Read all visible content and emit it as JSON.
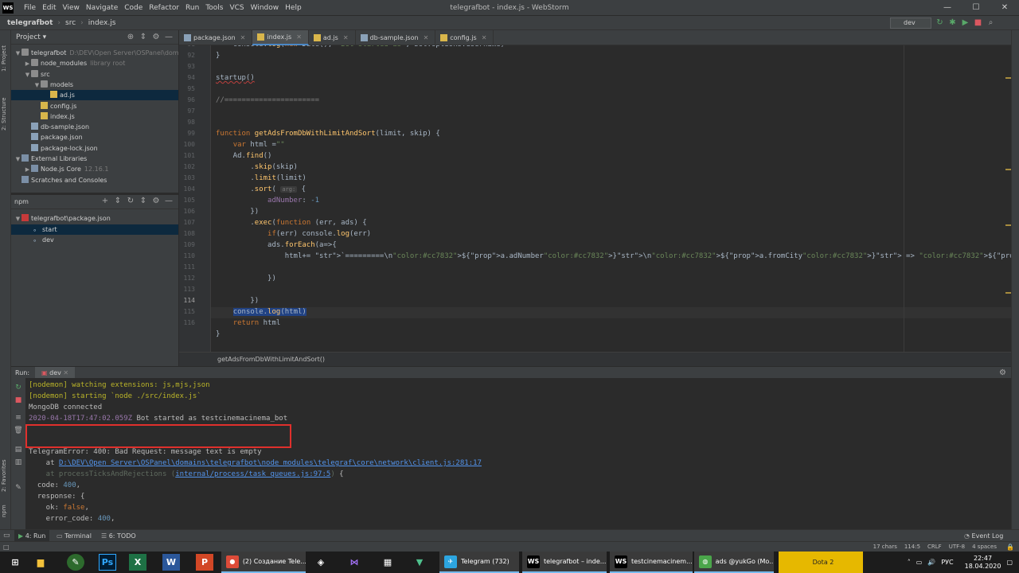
{
  "window": {
    "app_logo": "WS",
    "title": "telegrafbot - index.js - WebStorm",
    "menu": [
      "File",
      "Edit",
      "View",
      "Navigate",
      "Code",
      "Refactor",
      "Run",
      "Tools",
      "VCS",
      "Window",
      "Help"
    ],
    "controls": [
      "—",
      "☐",
      "✕"
    ]
  },
  "navbar": {
    "breadcrumb": [
      "telegrafbot",
      "src",
      "index.js"
    ],
    "run_config": "dev"
  },
  "left_strip": {
    "project_tab": "1: Project",
    "structure_tab": "2: Structure",
    "favorites_tab": "2: Favorites",
    "npm_tab": "npm"
  },
  "project": {
    "title": "Project",
    "tree": [
      {
        "label": "telegrafbot",
        "hint": "D:\\DEV\\Open Server\\OSPanel\\domains",
        "indent": 0,
        "arrow": "▼",
        "icon": "folder"
      },
      {
        "label": "node_modules",
        "hint": "library root",
        "indent": 1,
        "arrow": "▶",
        "icon": "folder"
      },
      {
        "label": "src",
        "hint": "",
        "indent": 1,
        "arrow": "▼",
        "icon": "folder"
      },
      {
        "label": "models",
        "hint": "",
        "indent": 2,
        "arrow": "▼",
        "icon": "folder"
      },
      {
        "label": "ad.js",
        "hint": "",
        "indent": 3,
        "arrow": "",
        "icon": "js",
        "selected": true
      },
      {
        "label": "config.js",
        "hint": "",
        "indent": 2,
        "arrow": "",
        "icon": "js"
      },
      {
        "label": "index.js",
        "hint": "",
        "indent": 2,
        "arrow": "",
        "icon": "js"
      },
      {
        "label": "db-sample.json",
        "hint": "",
        "indent": 1,
        "arrow": "",
        "icon": "json"
      },
      {
        "label": "package.json",
        "hint": "",
        "indent": 1,
        "arrow": "",
        "icon": "json"
      },
      {
        "label": "package-lock.json",
        "hint": "",
        "indent": 1,
        "arrow": "",
        "icon": "json"
      },
      {
        "label": "External Libraries",
        "hint": "",
        "indent": 0,
        "arrow": "▼",
        "icon": "lib"
      },
      {
        "label": "Node.js Core",
        "hint": "12.16.1",
        "indent": 1,
        "arrow": "▶",
        "icon": "lib"
      },
      {
        "label": "Scratches and Consoles",
        "hint": "",
        "indent": 0,
        "arrow": "",
        "icon": "lib"
      }
    ]
  },
  "npm": {
    "title": "npm",
    "tree": [
      {
        "label": "telegrafbot\\package.json",
        "indent": 0,
        "arrow": "▼"
      },
      {
        "label": "start",
        "indent": 1,
        "arrow": "",
        "selected": true
      },
      {
        "label": "dev",
        "indent": 1,
        "arrow": ""
      }
    ]
  },
  "tabs": [
    {
      "label": "package.json",
      "active": false
    },
    {
      "label": "index.js",
      "active": true
    },
    {
      "label": "ad.js",
      "active": false
    },
    {
      "label": "db-sample.json",
      "active": false
    },
    {
      "label": "config.js",
      "active": false
    }
  ],
  "editor": {
    "line_numbers": [
      "91",
      "92",
      "93",
      "94",
      "95",
      "96",
      "97",
      "98",
      "99",
      "100",
      "101",
      "102",
      "103",
      "104",
      "105",
      "106",
      "107",
      "108",
      "109",
      "110",
      "111",
      "112",
      "113",
      "114",
      "115",
      "116"
    ],
    "current_line": "114",
    "lines": [
      "    console.log(new Date(), 'Bot started as', bot.options.username)",
      "}",
      "",
      "startup()",
      "",
      "//======================",
      "",
      "",
      "function getAdsFromDbWithLimitAndSort(limit, skip) {",
      "    var html =\"\"",
      "    Ad.find()",
      "        .skip(skip)",
      "        .limit(limit)",
      "        .sort( arg: {",
      "            adNumber: -1",
      "        })",
      "        .exec(function (err, ads) {",
      "            if(err) console.log(err)",
      "            ads.forEach(a=>{",
      "                html+= `=========\\n${a.adNumber}\\n${a.fromCity} => ${a.toCity}\\n${a.vehicle}\\n${a.date}\\n${a.price}\\n${a.contact}\\n`",
      "",
      "            })",
      "",
      "        })",
      "    console.log(html)",
      "    return html",
      "}"
    ],
    "crumb": "getAdsFromDbWithLimitAndSort()"
  },
  "run": {
    "label": "Run:",
    "tab": "dev",
    "console": [
      {
        "text": "[nodemon] watching extensions: js,mjs,json",
        "cls": "nodemon"
      },
      {
        "text": "[nodemon] starting `node ./src/index.js`",
        "cls": "nodemon"
      },
      {
        "text": "MongoDB connected",
        "cls": ""
      },
      {
        "text": "2020-04-18T17:47:02.059Z Bot started as testcinemacinema_bot",
        "cls": ""
      },
      {
        "text": "",
        "cls": ""
      },
      {
        "text": "",
        "cls": ""
      },
      {
        "text": "TelegramError: 400: Bad Request: message text is empty",
        "cls": ""
      },
      {
        "text": "    at D:\\DEV\\Open Server\\OSPanel\\domains\\telegrafbot\\node_modules\\telegraf\\core\\network\\client.js:281:17",
        "cls": "at-link"
      },
      {
        "text": "    at processTicksAndRejections (internal/process/task_queues.js:97:5) {",
        "cls": "at-dim"
      },
      {
        "text": "  code: 400,",
        "cls": ""
      },
      {
        "text": "  response: {",
        "cls": ""
      },
      {
        "text": "    ok: false,",
        "cls": ""
      },
      {
        "text": "    error_code: 400,",
        "cls": ""
      }
    ]
  },
  "tool_tabs": [
    {
      "label": "4: Run",
      "active": true
    },
    {
      "label": "Terminal",
      "active": false
    },
    {
      "label": "6: TODO",
      "active": false
    }
  ],
  "event_log": "Event Log",
  "status": [
    "17 chars",
    "114:5",
    "CRLF",
    "UTF-8",
    "4 spaces"
  ],
  "taskbar": {
    "apps": [
      {
        "label": "(2) Создание Tele...",
        "glyph": "●",
        "color": "#dd4b39"
      },
      {
        "label": "Telegram (732)",
        "glyph": "✈",
        "color": "#2ca5e0"
      },
      {
        "label": "telegrafbot – inde...",
        "glyph": "WS",
        "color": "#000000"
      },
      {
        "label": "testcinemacinem...",
        "glyph": "WS",
        "color": "#000000"
      },
      {
        "label": "ads @yukGo (Mo...",
        "glyph": "◍",
        "color": "#4aa64a"
      },
      {
        "label": "Dota 2",
        "glyph": "",
        "color": "#a88b00"
      }
    ],
    "lang": "РУС",
    "time": "22:47",
    "date": "18.04.2020"
  }
}
